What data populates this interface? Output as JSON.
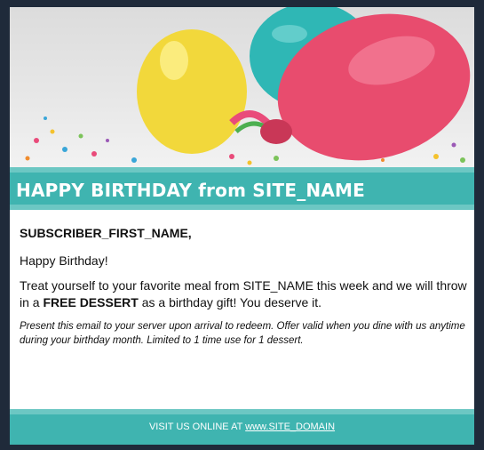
{
  "hero": {
    "image": "birthday-balloons-confetti"
  },
  "banner": {
    "title": "HAPPY BIRTHDAY from SITE_NAME"
  },
  "content": {
    "greeting": "SUBSCRIBER_FIRST_NAME,",
    "line1": "Happy Birthday!",
    "offer_pre": "Treat yourself to your favorite meal from SITE_NAME this week and we will throw in a ",
    "offer_bold": "FREE DESSERT",
    "offer_post": " as a birthday gift! You deserve it.",
    "note": "Present this email to your server upon arrival to redeem. Offer valid when you dine with us anytime during your birthday month. Limited to 1 time use for 1 dessert."
  },
  "footer": {
    "prefix": "VISIT US ONLINE AT ",
    "link": "www.SITE_DOMAIN"
  },
  "colors": {
    "teal": "#3fb4b0",
    "teal_light": "#6cc7c3",
    "background": "#1f2a3a"
  }
}
